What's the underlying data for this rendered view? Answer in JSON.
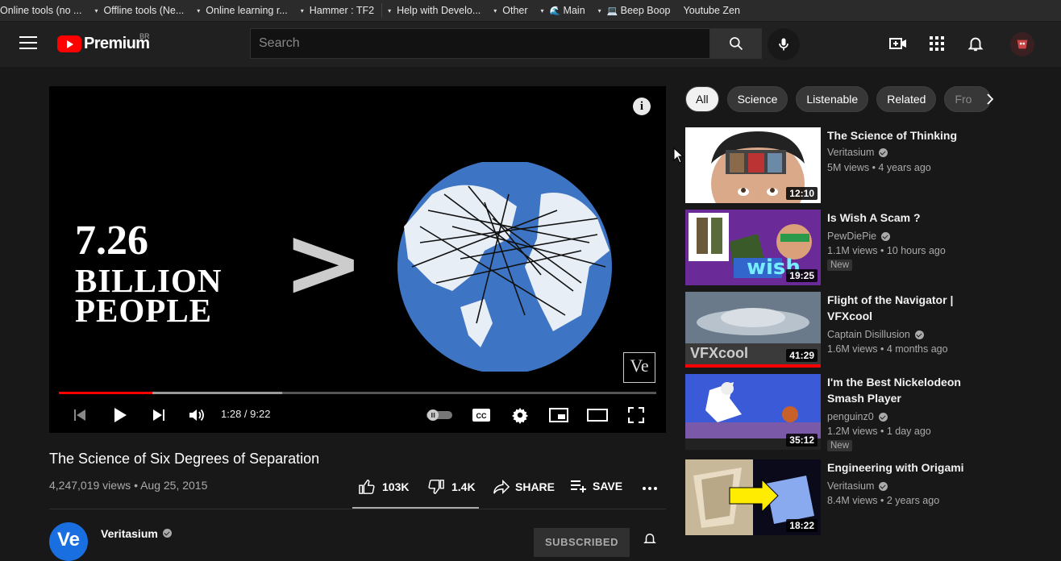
{
  "bookmarks": [
    {
      "label": "Online tools (no ...",
      "icon": "folder-icon"
    },
    {
      "label": "Offline tools (Ne...",
      "icon": "folder-icon"
    },
    {
      "label": "Online learning r...",
      "icon": "folder-icon"
    },
    {
      "label": "Hammer : TF2",
      "icon": "folder-icon"
    },
    {
      "label": "Help with Develo...",
      "icon": "folder-icon"
    },
    {
      "label": "Other",
      "icon": "folder-icon"
    },
    {
      "label": "Main",
      "icon": "wave-icon"
    },
    {
      "label": "Beep Boop",
      "icon": "laptop-icon"
    },
    {
      "label": "Youtube Zen",
      "icon": "none"
    }
  ],
  "header": {
    "logo_text": "Premium",
    "country": "BR",
    "search_placeholder": "Search"
  },
  "player": {
    "overlay_line1": "7.26",
    "overlay_line2": "BILLION",
    "overlay_line3": "PEOPLE",
    "greater_than": ">",
    "watermark": "Ve",
    "time": "1:28 / 9:22",
    "progress_played_fraction": 0.157,
    "progress_buffered_fraction": 0.374
  },
  "video": {
    "title": "The Science of Six Degrees of Separation",
    "meta": "4,247,019 views • Aug 25, 2015",
    "likes": "103K",
    "dislikes": "1.4K",
    "share_label": "SHARE",
    "save_label": "SAVE",
    "channel_name": "Veritasium",
    "channel_avatar_text": "Ve",
    "subscribe_label": "SUBSCRIBED"
  },
  "chips": [
    "All",
    "Science",
    "Listenable",
    "Related",
    "Fro"
  ],
  "recommendations": [
    {
      "title": "The Science of Thinking",
      "channel": "Veritasium",
      "stats": "5M views • 4 years ago",
      "duration": "12:10",
      "new": false,
      "watched_fraction": 0
    },
    {
      "title": "Is Wish A Scam ?",
      "channel": "PewDiePie",
      "stats": "1.1M views • 10 hours ago",
      "duration": "19:25",
      "new": true,
      "new_label": "New",
      "watched_fraction": 0
    },
    {
      "title": "Flight of the Navigator | VFXcool",
      "channel": "Captain Disillusion",
      "stats": "1.6M views • 4 months ago",
      "duration": "41:29",
      "new": false,
      "watched_fraction": 1.0
    },
    {
      "title": "I'm the Best Nickelodeon Smash Player",
      "channel": "penguinz0",
      "stats": "1.2M views • 1 day ago",
      "duration": "35:12",
      "new": true,
      "new_label": "New",
      "watched_fraction": 0
    },
    {
      "title": "Engineering with Origami",
      "channel": "Veritasium",
      "stats": "8.4M views • 2 years ago",
      "duration": "18:22",
      "new": false,
      "watched_fraction": 0
    }
  ],
  "thumb_texts": {
    "wish": "wish",
    "vfxcool": "VFXcool"
  }
}
